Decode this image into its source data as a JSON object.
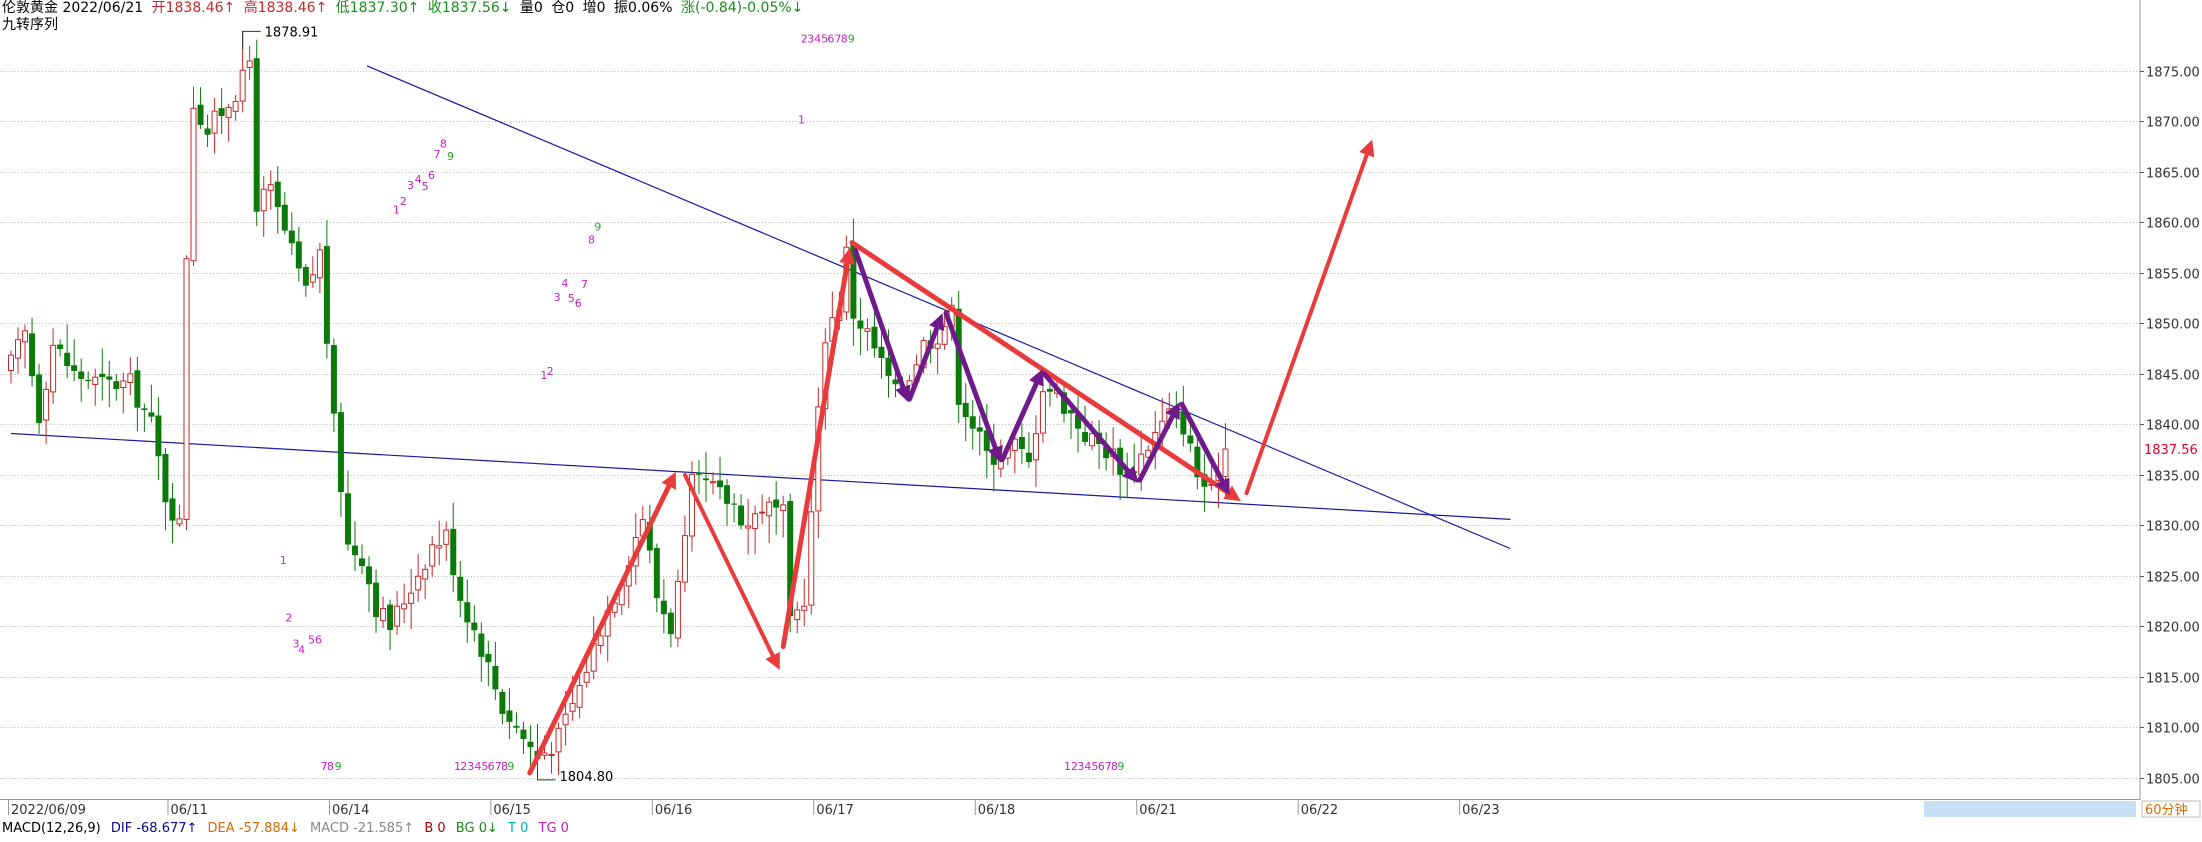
{
  "header": {
    "instrument": "伦敦黄金 2022/06/21",
    "open": "开1838.46↑",
    "high": "高1838.46↑",
    "low": "低1837.30↑",
    "close": "收1837.56↓",
    "volume": "量0",
    "position": "仓0",
    "increase": "增0",
    "amplitude": "振0.06%",
    "change": "涨(-0.84)-0.05%↓"
  },
  "indicator_name": "九转序列",
  "footer": {
    "macd_name": "MACD(12,26,9)",
    "dif": "DIF -68.677↑",
    "dea": "DEA -57.884↓",
    "macd": "MACD -21.585↑",
    "b": "B 0",
    "bg": "BG 0↓",
    "t": "T 0",
    "tg": "TG 0"
  },
  "colors": {
    "up": "#c22a2a",
    "down": "#0b7a0b",
    "trend": "#1a1aa0",
    "arrow_red": "#e93b3b",
    "arrow_purple": "#6e1a8a",
    "grid": "#bcbcbc",
    "nine_magenta": "#c21fc2",
    "nine_green": "#2aa52a",
    "price_tag": "#e5002a"
  },
  "chart_data": {
    "type": "candlestick",
    "timeframe": "60分钟",
    "ylim": [
      1804,
      1879
    ],
    "yticks": [
      1805,
      1810,
      1815,
      1820,
      1825,
      1830,
      1835,
      1840,
      1845,
      1850,
      1855,
      1860,
      1865,
      1870,
      1875
    ],
    "ytick_labels": [
      "1805.00",
      "1810.00",
      "1815.00",
      "1820.00",
      "1825.00",
      "1830.00",
      "1835.00",
      "1840.00",
      "1845.00",
      "1850.00",
      "1855.00",
      "1860.00",
      "1865.00",
      "1870.00",
      "1875.00"
    ],
    "date_labels": [
      {
        "bar": 0,
        "label": "2022/06/09"
      },
      {
        "bar": 24,
        "label": "06/11"
      },
      {
        "bar": 47,
        "label": "06/14"
      },
      {
        "bar": 70,
        "label": "06/15"
      },
      {
        "bar": 93,
        "label": "06/16"
      },
      {
        "bar": 116,
        "label": "06/17"
      },
      {
        "bar": 139,
        "label": "06/18"
      },
      {
        "bar": 162,
        "label": "06/21"
      },
      {
        "bar": 185,
        "label": "06/22"
      },
      {
        "bar": 208,
        "label": "06/23"
      }
    ],
    "high_label": {
      "bar": 33,
      "value": 1878.91,
      "label": "1878.91"
    },
    "low_label": {
      "bar": 75,
      "value": 1804.8,
      "label": "1804.80"
    },
    "last_price": {
      "value": 1837.56,
      "label": "1837.56"
    },
    "anchors": [
      {
        "i": 0,
        "p": 1846
      },
      {
        "i": 2,
        "p": 1849
      },
      {
        "i": 4,
        "p": 1841
      },
      {
        "i": 6,
        "p": 1848
      },
      {
        "i": 9,
        "p": 1845
      },
      {
        "i": 13,
        "p": 1844
      },
      {
        "i": 17,
        "p": 1844
      },
      {
        "i": 20,
        "p": 1840
      },
      {
        "i": 22,
        "p": 1833
      },
      {
        "i": 24,
        "p": 1830
      },
      {
        "i": 25,
        "p": 1857
      },
      {
        "i": 26,
        "p": 1872
      },
      {
        "i": 28,
        "p": 1869
      },
      {
        "i": 30,
        "p": 1871
      },
      {
        "i": 33,
        "p": 1874
      },
      {
        "i": 34,
        "p": 1876
      },
      {
        "i": 35,
        "p": 1862
      },
      {
        "i": 37,
        "p": 1863
      },
      {
        "i": 40,
        "p": 1857
      },
      {
        "i": 42,
        "p": 1853
      },
      {
        "i": 44,
        "p": 1857
      },
      {
        "i": 46,
        "p": 1840
      },
      {
        "i": 48,
        "p": 1828
      },
      {
        "i": 50,
        "p": 1827
      },
      {
        "i": 52,
        "p": 1822
      },
      {
        "i": 54,
        "p": 1820
      },
      {
        "i": 57,
        "p": 1824
      },
      {
        "i": 60,
        "p": 1828
      },
      {
        "i": 62,
        "p": 1829
      },
      {
        "i": 64,
        "p": 1823
      },
      {
        "i": 67,
        "p": 1818
      },
      {
        "i": 70,
        "p": 1812
      },
      {
        "i": 73,
        "p": 1809
      },
      {
        "i": 75,
        "p": 1807
      },
      {
        "i": 78,
        "p": 1809
      },
      {
        "i": 81,
        "p": 1814
      },
      {
        "i": 84,
        "p": 1820
      },
      {
        "i": 87,
        "p": 1825
      },
      {
        "i": 90,
        "p": 1831
      },
      {
        "i": 92,
        "p": 1823
      },
      {
        "i": 94,
        "p": 1820
      },
      {
        "i": 96,
        "p": 1828
      },
      {
        "i": 97,
        "p": 1834
      },
      {
        "i": 99,
        "p": 1834
      },
      {
        "i": 101,
        "p": 1833
      },
      {
        "i": 103,
        "p": 1832
      },
      {
        "i": 105,
        "p": 1830
      },
      {
        "i": 107,
        "p": 1832
      },
      {
        "i": 110,
        "p": 1831
      },
      {
        "i": 111,
        "p": 1820
      },
      {
        "i": 113,
        "p": 1823
      },
      {
        "i": 114,
        "p": 1831
      },
      {
        "i": 115,
        "p": 1841
      },
      {
        "i": 116,
        "p": 1849
      },
      {
        "i": 118,
        "p": 1852
      },
      {
        "i": 119,
        "p": 1857
      },
      {
        "i": 120,
        "p": 1851
      },
      {
        "i": 122,
        "p": 1849
      },
      {
        "i": 124,
        "p": 1846
      },
      {
        "i": 126,
        "p": 1843
      },
      {
        "i": 128,
        "p": 1845
      },
      {
        "i": 130,
        "p": 1848
      },
      {
        "i": 132,
        "p": 1849
      },
      {
        "i": 134,
        "p": 1851
      },
      {
        "i": 135,
        "p": 1843
      },
      {
        "i": 137,
        "p": 1840
      },
      {
        "i": 139,
        "p": 1837
      },
      {
        "i": 141,
        "p": 1837
      },
      {
        "i": 143,
        "p": 1838
      },
      {
        "i": 145,
        "p": 1836
      },
      {
        "i": 147,
        "p": 1844
      },
      {
        "i": 149,
        "p": 1843
      },
      {
        "i": 151,
        "p": 1841
      },
      {
        "i": 153,
        "p": 1839
      },
      {
        "i": 155,
        "p": 1838
      },
      {
        "i": 157,
        "p": 1837
      },
      {
        "i": 159,
        "p": 1835
      },
      {
        "i": 161,
        "p": 1837
      },
      {
        "i": 163,
        "p": 1839
      },
      {
        "i": 165,
        "p": 1841
      },
      {
        "i": 167,
        "p": 1840
      },
      {
        "i": 169,
        "p": 1835
      },
      {
        "i": 171,
        "p": 1833
      },
      {
        "i": 172,
        "p": 1836
      },
      {
        "i": 173,
        "p": 1837.56
      }
    ],
    "trendlines": [
      {
        "from": {
          "bar": 50.7,
          "price": 1875.5
        },
        "to": {
          "bar": 213.6,
          "price": 1827.7
        }
      },
      {
        "from": {
          "bar": 0,
          "price": 1839.1
        },
        "to": {
          "bar": 213.6,
          "price": 1830.6
        }
      }
    ],
    "arrows": [
      {
        "color": "arrow_red",
        "from": {
          "bar": 73.9,
          "price": 1805.5
        },
        "to": {
          "bar": 94.7,
          "price": 1835.3
        },
        "width": 5
      },
      {
        "color": "arrow_red",
        "from": {
          "bar": 96.0,
          "price": 1835.0
        },
        "to": {
          "bar": 109.5,
          "price": 1815.7
        },
        "width": 4
      },
      {
        "color": "arrow_red",
        "from": {
          "bar": 110.0,
          "price": 1818.0
        },
        "to": {
          "bar": 119.5,
          "price": 1857.5
        },
        "width": 5
      },
      {
        "color": "arrow_red",
        "from": {
          "bar": 119.8,
          "price": 1858.0
        },
        "to": {
          "bar": 175.2,
          "price": 1832.4
        },
        "width": 5
      },
      {
        "color": "arrow_red",
        "from": {
          "bar": 176.0,
          "price": 1833.2
        },
        "to": {
          "bar": 193.9,
          "price": 1868.2
        },
        "width": 4
      },
      {
        "color": "arrow_purple",
        "from": {
          "bar": 120.3,
          "price": 1857.2
        },
        "to": {
          "bar": 127.8,
          "price": 1842.2
        },
        "width": 5
      },
      {
        "color": "arrow_purple",
        "from": {
          "bar": 128.0,
          "price": 1842.5
        },
        "to": {
          "bar": 132.7,
          "price": 1851.0
        },
        "width": 5
      },
      {
        "color": "arrow_purple",
        "from": {
          "bar": 133.2,
          "price": 1851.0
        },
        "to": {
          "bar": 141.0,
          "price": 1836.2
        },
        "width": 5
      },
      {
        "color": "arrow_purple",
        "from": {
          "bar": 141.2,
          "price": 1836.5
        },
        "to": {
          "bar": 147.0,
          "price": 1845.5
        },
        "width": 5
      },
      {
        "color": "arrow_purple",
        "from": {
          "bar": 147.2,
          "price": 1845.0
        },
        "to": {
          "bar": 160.6,
          "price": 1834.2
        },
        "width": 5
      },
      {
        "color": "arrow_purple",
        "from": {
          "bar": 160.8,
          "price": 1834.5
        },
        "to": {
          "bar": 166.5,
          "price": 1842.2
        },
        "width": 5
      },
      {
        "color": "arrow_purple",
        "from": {
          "bar": 166.8,
          "price": 1842.0
        },
        "to": {
          "bar": 173.6,
          "price": 1833.0
        },
        "width": 5
      }
    ],
    "nine_sequence": [
      {
        "bar": 38.8,
        "price": 1826.2,
        "text": "1",
        "color": "nine_magenta"
      },
      {
        "bar": 39.6,
        "price": 1820.5,
        "text": "2",
        "color": "nine_magenta"
      },
      {
        "bar": 40.6,
        "price": 1817.9,
        "text": "3",
        "color": "nine_magenta"
      },
      {
        "bar": 41.4,
        "price": 1817.3,
        "text": "4",
        "color": "nine_magenta"
      },
      {
        "bar": 42.8,
        "price": 1818.3,
        "text": "5",
        "color": "nine_magenta"
      },
      {
        "bar": 43.8,
        "price": 1818.3,
        "text": "6",
        "color": "nine_magenta"
      },
      {
        "bar": 44.6,
        "price": 1805.8,
        "text": "7",
        "color": "nine_magenta"
      },
      {
        "bar": 45.5,
        "price": 1805.8,
        "text": "8",
        "color": "nine_magenta"
      },
      {
        "bar": 46.6,
        "price": 1805.8,
        "text": "9",
        "color": "nine_green"
      },
      {
        "bar": 54.9,
        "price": 1860.9,
        "text": "1",
        "color": "nine_magenta"
      },
      {
        "bar": 55.9,
        "price": 1861.7,
        "text": "2",
        "color": "nine_magenta"
      },
      {
        "bar": 56.9,
        "price": 1863.3,
        "text": "3",
        "color": "nine_magenta"
      },
      {
        "bar": 58.0,
        "price": 1863.9,
        "text": "4",
        "color": "nine_magenta"
      },
      {
        "bar": 59.0,
        "price": 1863.2,
        "text": "5",
        "color": "nine_magenta"
      },
      {
        "bar": 59.9,
        "price": 1864.3,
        "text": "6",
        "color": "nine_magenta"
      },
      {
        "bar": 60.7,
        "price": 1866.4,
        "text": "7",
        "color": "nine_magenta"
      },
      {
        "bar": 61.6,
        "price": 1867.4,
        "text": "8",
        "color": "nine_magenta"
      },
      {
        "bar": 62.6,
        "price": 1866.2,
        "text": "9",
        "color": "nine_green"
      },
      {
        "bar": 63.6,
        "price": 1805.8,
        "text": "1",
        "color": "nine_magenta"
      },
      {
        "bar": 64.5,
        "price": 1805.8,
        "text": "2",
        "color": "nine_magenta"
      },
      {
        "bar": 65.5,
        "price": 1805.8,
        "text": "3",
        "color": "nine_magenta"
      },
      {
        "bar": 66.5,
        "price": 1805.8,
        "text": "4",
        "color": "nine_magenta"
      },
      {
        "bar": 67.5,
        "price": 1805.8,
        "text": "5",
        "color": "nine_magenta"
      },
      {
        "bar": 68.4,
        "price": 1805.8,
        "text": "6",
        "color": "nine_magenta"
      },
      {
        "bar": 69.4,
        "price": 1805.8,
        "text": "7",
        "color": "nine_magenta"
      },
      {
        "bar": 70.3,
        "price": 1805.8,
        "text": "8",
        "color": "nine_magenta"
      },
      {
        "bar": 71.2,
        "price": 1805.8,
        "text": "9",
        "color": "nine_green"
      },
      {
        "bar": 75.9,
        "price": 1844.5,
        "text": "1",
        "color": "nine_magenta"
      },
      {
        "bar": 76.8,
        "price": 1844.9,
        "text": "2",
        "color": "nine_magenta"
      },
      {
        "bar": 77.8,
        "price": 1852.2,
        "text": "3",
        "color": "nine_magenta"
      },
      {
        "bar": 78.9,
        "price": 1853.6,
        "text": "4",
        "color": "nine_magenta"
      },
      {
        "bar": 79.8,
        "price": 1852.1,
        "text": "5",
        "color": "nine_magenta"
      },
      {
        "bar": 80.8,
        "price": 1851.6,
        "text": "6",
        "color": "nine_magenta"
      },
      {
        "bar": 81.7,
        "price": 1853.5,
        "text": "7",
        "color": "nine_magenta"
      },
      {
        "bar": 82.7,
        "price": 1857.9,
        "text": "8",
        "color": "nine_magenta"
      },
      {
        "bar": 83.6,
        "price": 1859.2,
        "text": "9",
        "color": "nine_green"
      },
      {
        "bar": 113.0,
        "price": 1877.8,
        "text": "2",
        "color": "nine_magenta"
      },
      {
        "bar": 113.9,
        "price": 1877.8,
        "text": "3",
        "color": "nine_magenta"
      },
      {
        "bar": 114.9,
        "price": 1877.8,
        "text": "4",
        "color": "nine_magenta"
      },
      {
        "bar": 115.9,
        "price": 1877.8,
        "text": "5",
        "color": "nine_magenta"
      },
      {
        "bar": 116.8,
        "price": 1877.8,
        "text": "6",
        "color": "nine_magenta"
      },
      {
        "bar": 117.8,
        "price": 1877.8,
        "text": "7",
        "color": "nine_magenta"
      },
      {
        "bar": 118.7,
        "price": 1877.8,
        "text": "8",
        "color": "nine_magenta"
      },
      {
        "bar": 119.7,
        "price": 1877.8,
        "text": "9",
        "color": "nine_green"
      },
      {
        "bar": 112.6,
        "price": 1869.8,
        "text": "1",
        "color": "nine_magenta"
      },
      {
        "bar": 150.5,
        "price": 1805.8,
        "text": "1",
        "color": "nine_magenta"
      },
      {
        "bar": 151.5,
        "price": 1805.8,
        "text": "2",
        "color": "nine_magenta"
      },
      {
        "bar": 152.4,
        "price": 1805.8,
        "text": "3",
        "color": "nine_magenta"
      },
      {
        "bar": 153.4,
        "price": 1805.8,
        "text": "4",
        "color": "nine_magenta"
      },
      {
        "bar": 154.4,
        "price": 1805.8,
        "text": "5",
        "color": "nine_magenta"
      },
      {
        "bar": 155.3,
        "price": 1805.8,
        "text": "6",
        "color": "nine_magenta"
      },
      {
        "bar": 156.3,
        "price": 1805.8,
        "text": "7",
        "color": "nine_magenta"
      },
      {
        "bar": 157.2,
        "price": 1805.8,
        "text": "8",
        "color": "nine_magenta"
      },
      {
        "bar": 158.1,
        "price": 1805.8,
        "text": "9",
        "color": "nine_green"
      }
    ]
  }
}
